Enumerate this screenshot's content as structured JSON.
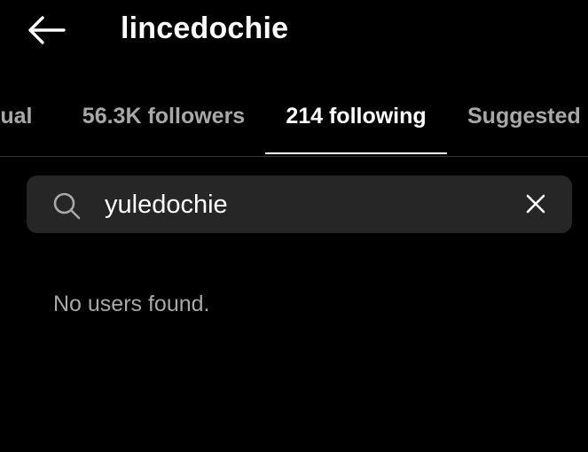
{
  "header": {
    "title": "lincedochie",
    "back_icon": "arrow-left-icon"
  },
  "tabs": [
    {
      "label": "tual",
      "active": false
    },
    {
      "label": "56.3K followers",
      "active": false
    },
    {
      "label": "214 following",
      "active": true
    },
    {
      "label": "Suggested",
      "active": false
    }
  ],
  "search": {
    "value": "yuledochie",
    "search_icon": "search-icon",
    "clear_icon": "close-icon"
  },
  "results": {
    "empty_message": "No users found."
  },
  "colors": {
    "background": "#000000",
    "text_primary": "#ffffff",
    "text_secondary": "#a8a8a8",
    "search_background": "#262626",
    "divider": "#363636"
  }
}
